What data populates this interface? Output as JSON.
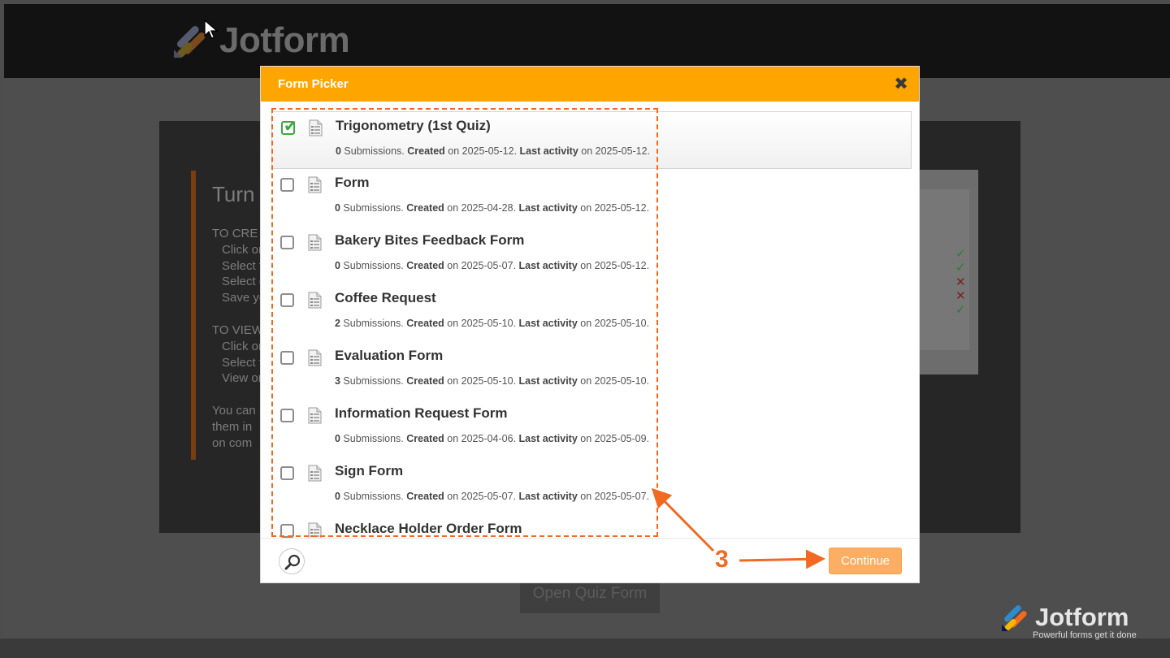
{
  "app": {
    "brand_name": "Jotform",
    "brand_tagline": "Powerful forms get it done"
  },
  "background": {
    "heading": "Turn",
    "lines": [
      "TO CRE",
      "Click or",
      "Select t",
      "Select c",
      "Save yo",
      "TO VIEW",
      "Click or",
      "Select t",
      "View or",
      "You can",
      "them in",
      "on com"
    ],
    "button_label": "Open Quiz Form"
  },
  "modal": {
    "title": "Form Picker",
    "close_icon": "close-x-icon",
    "forms": [
      {
        "title": "Trigonometry (1st Quiz)",
        "submissions": "0",
        "created": "2025-05-12",
        "last_activity": "2025-05-12",
        "checked": true
      },
      {
        "title": "Form",
        "submissions": "0",
        "created": "2025-04-28",
        "last_activity": "2025-05-12",
        "checked": false
      },
      {
        "title": "Bakery Bites Feedback Form",
        "submissions": "0",
        "created": "2025-05-07",
        "last_activity": "2025-05-12",
        "checked": false
      },
      {
        "title": "Coffee Request",
        "submissions": "2",
        "created": "2025-05-10",
        "last_activity": "2025-05-10",
        "checked": false
      },
      {
        "title": "Evaluation Form",
        "submissions": "3",
        "created": "2025-05-10",
        "last_activity": "2025-05-10",
        "checked": false
      },
      {
        "title": "Information Request Form",
        "submissions": "0",
        "created": "2025-04-06",
        "last_activity": "2025-05-09",
        "checked": false
      },
      {
        "title": "Sign Form",
        "submissions": "0",
        "created": "2025-05-07",
        "last_activity": "2025-05-07",
        "checked": false
      },
      {
        "title": "Necklace Holder Order Form",
        "submissions": "",
        "created": "",
        "last_activity": "",
        "checked": false
      }
    ],
    "meta_labels": {
      "submissions": "Submissions.",
      "created": "Created",
      "on": "on",
      "last_activity": "Last activity"
    },
    "continue_label": "Continue",
    "search_icon": "magnifier-icon"
  },
  "annotation": {
    "step_number": "3",
    "color": "#f26a21"
  },
  "colors": {
    "header_orange": "#fea500",
    "continue_button": "#fdae63",
    "check_green": "#3fa640"
  }
}
